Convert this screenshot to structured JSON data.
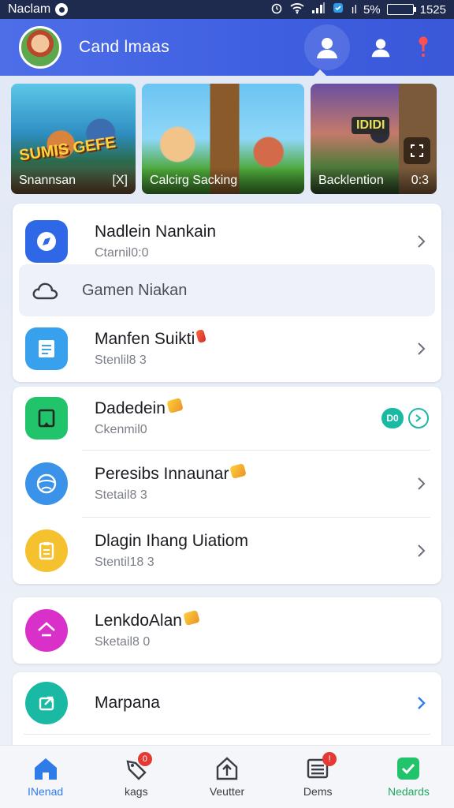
{
  "status_bar": {
    "left_text": "Naclam",
    "battery_text": "5%",
    "time": "1525",
    "signal_text": "ıl"
  },
  "header": {
    "title": "Cand lmaas"
  },
  "games": [
    {
      "caption": "Snannsan",
      "badge": "[X]",
      "logo": "SUMIS GEFE"
    },
    {
      "caption": "Calcirg Sacking",
      "badge": "",
      "logo": ""
    },
    {
      "caption": "Backlention",
      "badge": "0:3",
      "logo": "IDIDI"
    }
  ],
  "card1": {
    "items": [
      {
        "title": "Nadlein Nankain",
        "subtitle": "Ctarnil0:0"
      },
      {
        "title": "Gamen Niakan"
      },
      {
        "title": "Manfen Suikti",
        "subtitle": "Stenlil8 3"
      }
    ]
  },
  "card2": {
    "items": [
      {
        "title": "Dadedein",
        "subtitle": "Ckenmil0",
        "pill": "D0"
      },
      {
        "title": "Peresibs Innaunar",
        "subtitle": "Stetail8 3"
      },
      {
        "title": "Dlagin Ihang Uiatiom",
        "subtitle": "Stentil18 3"
      }
    ]
  },
  "card3": {
    "items": [
      {
        "title": "LenkdoAlan",
        "subtitle": "Sketail8 0"
      }
    ]
  },
  "card4": {
    "items": [
      {
        "title": "Marpana"
      }
    ]
  },
  "bottom_nav": [
    {
      "label": "INenad",
      "active": true
    },
    {
      "label": "kags",
      "badge": "0"
    },
    {
      "label": "Veutter"
    },
    {
      "label": "Dems",
      "badge": "!"
    },
    {
      "label": "Nedards"
    }
  ],
  "colors": {
    "header": "#3e5fe0",
    "accent_blue": "#2e68e6",
    "accent_teal": "#19b9a3",
    "accent_green": "#21c36b",
    "badge_red": "#e53935"
  }
}
